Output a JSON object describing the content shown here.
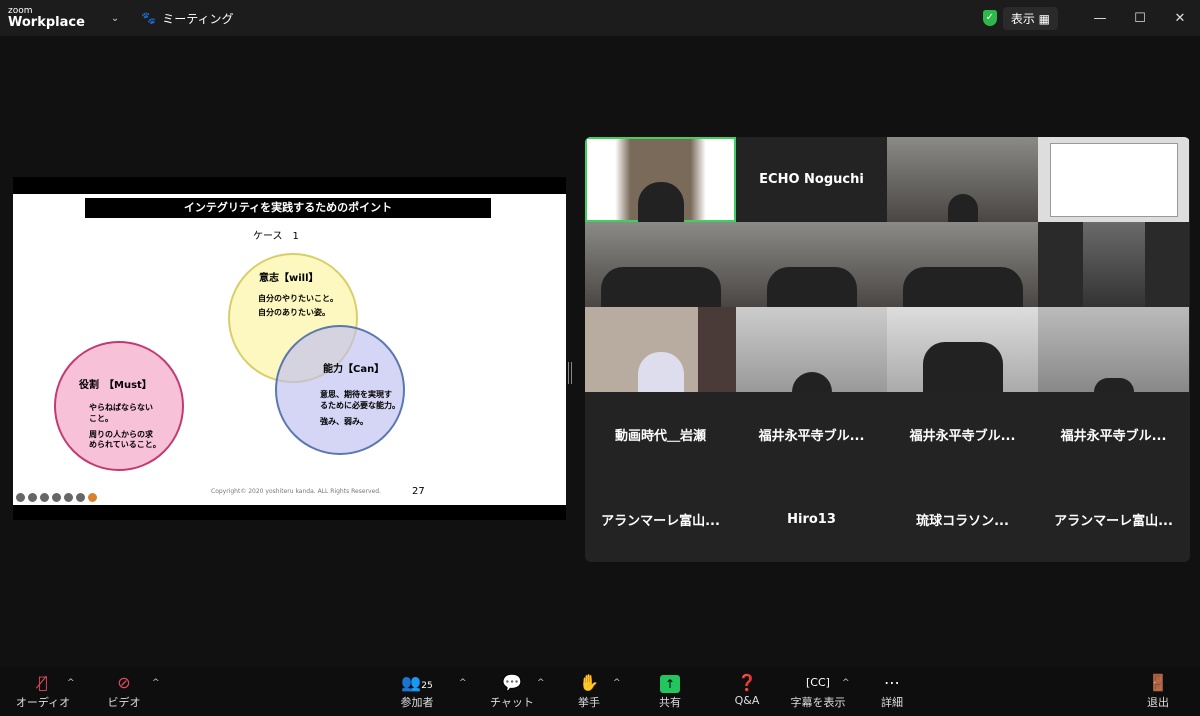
{
  "titlebar": {
    "brand_small": "zoom",
    "brand": "Workplace",
    "meeting_label": "ミーティング",
    "view_label": "表示",
    "minimize": "—",
    "maximize": "☐",
    "close": "✕"
  },
  "slide": {
    "title": "インテグリティを実践するためのポイント",
    "case": "ケース　1",
    "will": {
      "head": "意志【will】",
      "lines": [
        "自分のやりたいこと。",
        "自分のありたい姿。"
      ]
    },
    "can": {
      "head": "能力【Can】",
      "lines": [
        "意思、期待を実現す",
        "るために必要な能力。",
        "強み、弱み。"
      ]
    },
    "must": {
      "head": "役割　【Must】",
      "lines": [
        "やらねばならない",
        "こと。",
        "周りの人からの求",
        "められていること。"
      ]
    },
    "copyright": "Copyright© 2020 yoshiteru kanda. ALL Rights Reserved.",
    "page": "27"
  },
  "participants": {
    "named": [
      "ECHO Noguchi"
    ],
    "row4": [
      "動画時代＿岩瀬",
      "福井永平寺ブル...",
      "福井永平寺ブル...",
      "福井永平寺ブル..."
    ],
    "row5": [
      "アランマーレ富山...",
      "Hiro13",
      "琉球コラソン...",
      "アランマーレ富山..."
    ]
  },
  "toolbar": {
    "audio": "オーディオ",
    "video": "ビデオ",
    "participants": "参加者",
    "participants_count": "25",
    "chat": "チャット",
    "raise_hand": "挙手",
    "share": "共有",
    "qa": "Q&A",
    "captions": "字幕を表示",
    "more": "詳細",
    "leave": "退出"
  },
  "colors": {
    "will": "#fdf7b4",
    "can": "#cfd0f2",
    "must": "#f7c1d8",
    "share": "#22c55e",
    "active_speaker": "#3fd15f"
  }
}
